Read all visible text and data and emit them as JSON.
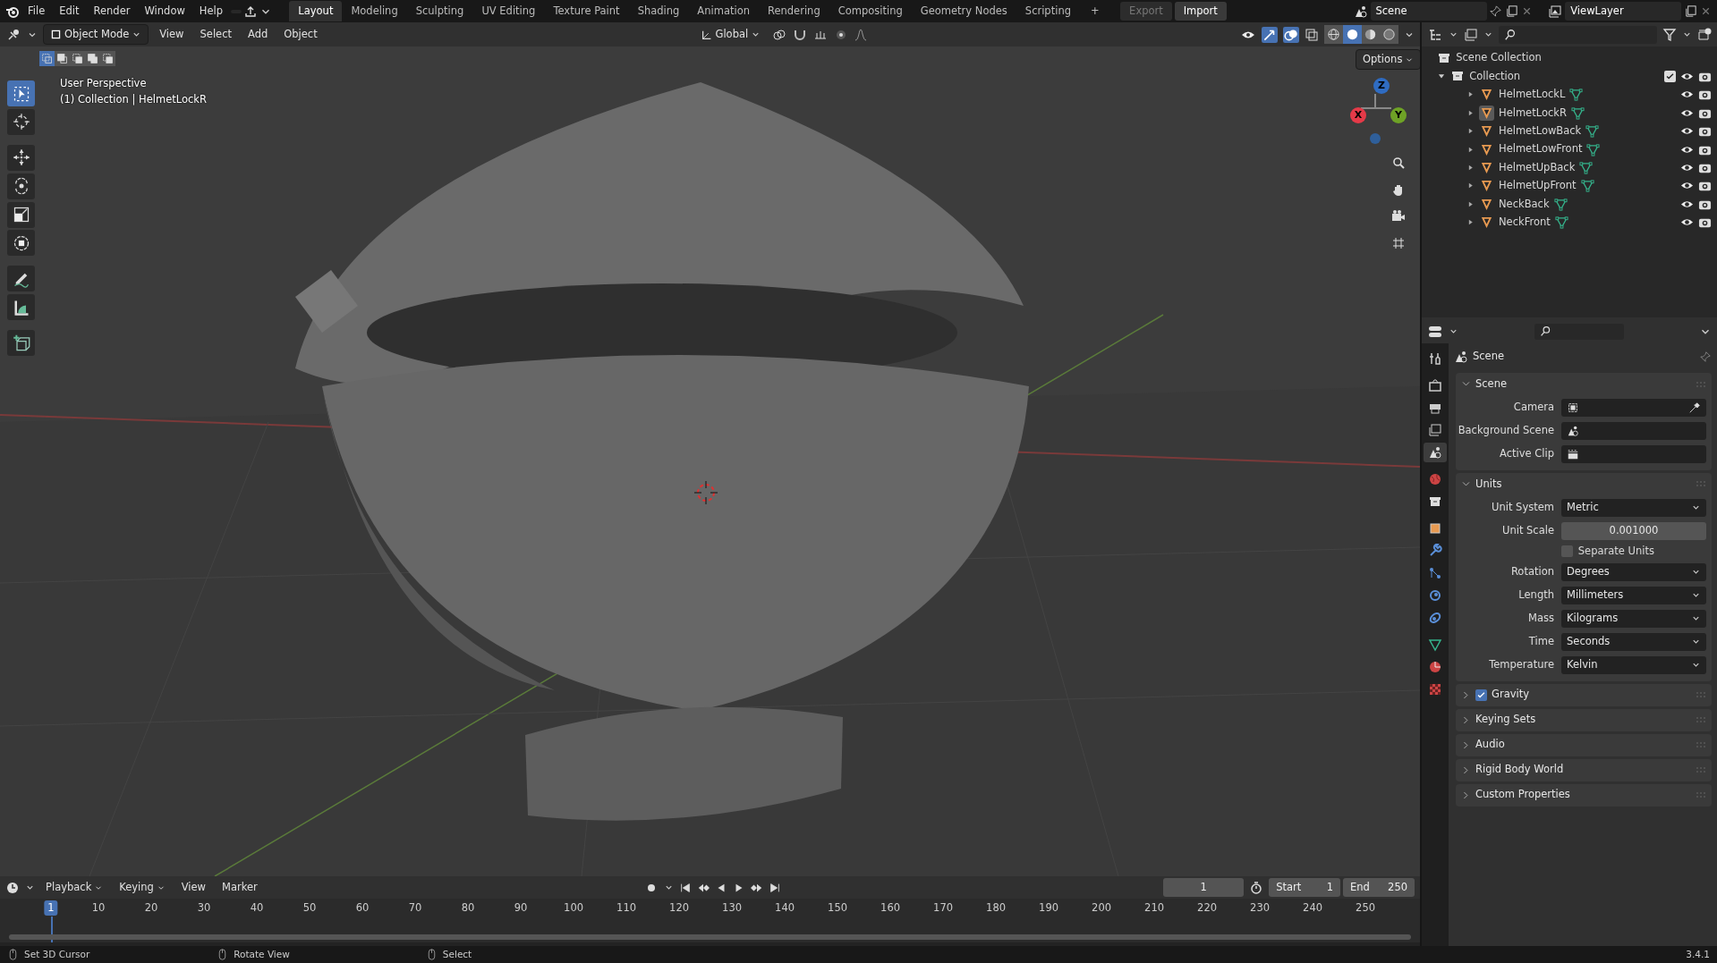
{
  "menu": [
    "File",
    "Edit",
    "Render",
    "Window",
    "Help"
  ],
  "workspaces": [
    {
      "label": "Layout",
      "selected": true
    },
    {
      "label": "Modeling",
      "selected": false
    },
    {
      "label": "Sculpting",
      "selected": false
    },
    {
      "label": "UV Editing",
      "selected": false
    },
    {
      "label": "Texture Paint",
      "selected": false
    },
    {
      "label": "Shading",
      "selected": false
    },
    {
      "label": "Animation",
      "selected": false
    },
    {
      "label": "Rendering",
      "selected": false
    },
    {
      "label": "Compositing",
      "selected": false
    },
    {
      "label": "Geometry Nodes",
      "selected": false
    },
    {
      "label": "Scripting",
      "selected": false
    }
  ],
  "add_workspace": "+",
  "file_actions": [
    {
      "label": "Export",
      "disabled": true
    },
    {
      "label": "Import",
      "disabled": false
    }
  ],
  "scene": "Scene",
  "view_layer": "ViewLayer",
  "viewport_header": {
    "mode": "Object Mode",
    "menus": [
      "View",
      "Select",
      "Add",
      "Object"
    ],
    "orientation": "Global",
    "options": "Options",
    "select_modes": [
      {
        "selected": true
      },
      {
        "selected": false
      },
      {
        "selected": false
      },
      {
        "selected": false
      },
      {
        "selected": false
      }
    ],
    "shading": [
      {
        "kind": "wireframe",
        "selected": false
      },
      {
        "kind": "solid",
        "selected": true
      },
      {
        "kind": "material",
        "selected": false
      },
      {
        "kind": "rendered",
        "selected": false
      }
    ]
  },
  "viewport": {
    "info": [
      "User Perspective",
      "(1) Collection | HelmetLockR"
    ],
    "axes": [
      "X",
      "Y",
      "Z"
    ],
    "picture": {
      "kind": "picture"
    }
  },
  "toolbar": [
    {
      "kind": "select",
      "selected": true
    },
    {
      "kind": "cursor",
      "selected": false
    },
    {
      "kind": "move",
      "selected": false
    },
    {
      "kind": "rotate",
      "selected": false
    },
    {
      "kind": "scale",
      "selected": false
    },
    {
      "kind": "transform",
      "selected": false
    },
    {
      "kind": "annotate",
      "selected": false
    },
    {
      "kind": "measure",
      "selected": false
    },
    {
      "kind": "add_cube",
      "selected": false
    }
  ],
  "outliner": {
    "root": "Scene Collection",
    "collection": {
      "label": "Collection",
      "expanded": true,
      "checked": true,
      "children": [
        {
          "label": "HelmetLockL",
          "selected": false
        },
        {
          "label": "HelmetLockR",
          "selected": true
        },
        {
          "label": "HelmetLowBack",
          "selected": false
        },
        {
          "label": "HelmetLowFront",
          "selected": false
        },
        {
          "label": "HelmetUpBack",
          "selected": false
        },
        {
          "label": "HelmetUpFront",
          "selected": false
        },
        {
          "label": "NeckBack",
          "selected": false
        },
        {
          "label": "NeckFront",
          "selected": false
        }
      ]
    }
  },
  "properties": {
    "title": "Scene",
    "tabs": [
      {
        "kind": "tool",
        "selected": false
      },
      {
        "kind": "render",
        "selected": false
      },
      {
        "kind": "output",
        "selected": false
      },
      {
        "kind": "view_layer",
        "selected": false
      },
      {
        "kind": "scene",
        "selected": true
      },
      {
        "kind": "world",
        "selected": false
      },
      {
        "kind": "collection",
        "selected": false
      },
      {
        "kind": "object",
        "selected": false
      },
      {
        "kind": "modifiers",
        "selected": false
      },
      {
        "kind": "particles",
        "selected": false
      },
      {
        "kind": "physics",
        "selected": false
      },
      {
        "kind": "constraints",
        "selected": false
      },
      {
        "kind": "data",
        "selected": false
      },
      {
        "kind": "material",
        "selected": false
      },
      {
        "kind": "texture",
        "selected": false
      }
    ],
    "panels": [
      {
        "title": "Scene",
        "expanded": true,
        "rows": [
          {
            "kind": "camera",
            "label": "Camera"
          },
          {
            "kind": "scene",
            "label": "Background Scene"
          },
          {
            "kind": "clip",
            "label": "Active Clip"
          }
        ]
      },
      {
        "title": "Units",
        "expanded": true,
        "rows": [
          {
            "kind": "dropdown",
            "label": "Unit System",
            "value": "Metric"
          },
          {
            "kind": "number",
            "label": "Unit Scale",
            "value": "0.001000"
          },
          {
            "kind": "checkbox",
            "label": "Separate Units",
            "checked": false
          },
          {
            "kind": "dropdown",
            "label": "Rotation",
            "value": "Degrees"
          },
          {
            "kind": "dropdown",
            "label": "Length",
            "value": "Millimeters"
          },
          {
            "kind": "dropdown",
            "label": "Mass",
            "value": "Kilograms"
          },
          {
            "kind": "dropdown",
            "label": "Time",
            "value": "Seconds"
          },
          {
            "kind": "dropdown",
            "label": "Temperature",
            "value": "Kelvin"
          }
        ]
      },
      {
        "title": "Gravity",
        "expanded": false,
        "kind": "checkbox",
        "checked": true
      },
      {
        "title": "Keying Sets",
        "expanded": false
      },
      {
        "title": "Audio",
        "expanded": false
      },
      {
        "title": "Rigid Body World",
        "expanded": false
      },
      {
        "title": "Custom Properties",
        "expanded": false
      }
    ]
  },
  "timeline": {
    "menus": [
      "Playback",
      "Keying",
      "View",
      "Marker"
    ],
    "current_frame": "1",
    "start_label": "Start",
    "start": "1",
    "end_label": "End",
    "end": "250",
    "ticks": [
      {
        "label": "1",
        "selected": true
      },
      {
        "label": "10",
        "selected": false
      },
      {
        "label": "20",
        "selected": false
      },
      {
        "label": "30",
        "selected": false
      },
      {
        "label": "40",
        "selected": false
      },
      {
        "label": "50",
        "selected": false
      },
      {
        "label": "60",
        "selected": false
      },
      {
        "label": "70",
        "selected": false
      },
      {
        "label": "80",
        "selected": false
      },
      {
        "label": "90",
        "selected": false
      },
      {
        "label": "100",
        "selected": false
      },
      {
        "label": "110",
        "selected": false
      },
      {
        "label": "120",
        "selected": false
      },
      {
        "label": "130",
        "selected": false
      },
      {
        "label": "140",
        "selected": false
      },
      {
        "label": "150",
        "selected": false
      },
      {
        "label": "160",
        "selected": false
      },
      {
        "label": "170",
        "selected": false
      },
      {
        "label": "180",
        "selected": false
      },
      {
        "label": "190",
        "selected": false
      },
      {
        "label": "200",
        "selected": false
      },
      {
        "label": "210",
        "selected": false
      },
      {
        "label": "220",
        "selected": false
      },
      {
        "label": "230",
        "selected": false
      },
      {
        "label": "240",
        "selected": false
      },
      {
        "label": "250",
        "selected": false
      }
    ]
  },
  "status_bar": {
    "hints": [
      "Set 3D Cursor",
      "Rotate View",
      "Select"
    ],
    "version": "3.4.1"
  }
}
